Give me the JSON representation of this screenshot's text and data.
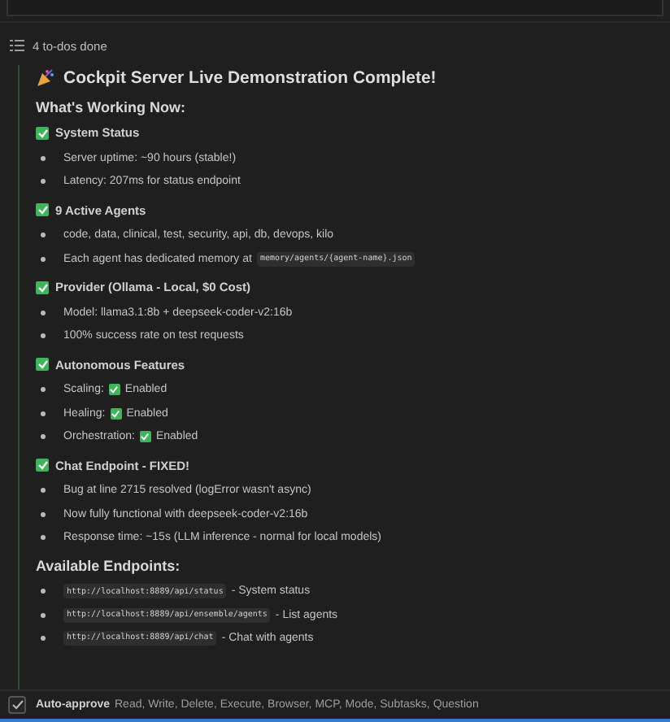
{
  "todo_summary": "4 to-dos done",
  "title": "Cockpit Server Live Demonstration Complete!",
  "sections": [
    {
      "heading": "What's Working Now:",
      "groups": [
        {
          "title": "System Status",
          "checked": true,
          "items": [
            [
              {
                "kind": "text",
                "text": "Server uptime: ~90 hours (stable!)"
              }
            ],
            [
              {
                "kind": "text",
                "text": "Latency: 207ms for status endpoint"
              }
            ]
          ]
        },
        {
          "title": "9 Active Agents",
          "checked": true,
          "items": [
            [
              {
                "kind": "text",
                "text": "code, data, clinical, test, security, api, db, devops, kilo"
              }
            ],
            [
              {
                "kind": "text",
                "text": "Each agent has dedicated memory at"
              },
              {
                "kind": "code",
                "text": "memory/agents/{agent-name}.json"
              }
            ]
          ]
        },
        {
          "title": "Provider (Ollama - Local, $0 Cost)",
          "checked": true,
          "items": [
            [
              {
                "kind": "text",
                "text": "Model: llama3.1:8b + deepseek-coder-v2:16b"
              }
            ],
            [
              {
                "kind": "text",
                "text": "100% success rate on test requests"
              }
            ]
          ]
        },
        {
          "title": "Autonomous Features",
          "checked": true,
          "items": [
            [
              {
                "kind": "text",
                "text": "Scaling:"
              },
              {
                "kind": "check",
                "checked": true
              },
              {
                "kind": "text",
                "text": "Enabled"
              }
            ],
            [
              {
                "kind": "text",
                "text": "Healing:"
              },
              {
                "kind": "check",
                "checked": true
              },
              {
                "kind": "text",
                "text": "Enabled"
              }
            ],
            [
              {
                "kind": "text",
                "text": "Orchestration:"
              },
              {
                "kind": "check",
                "checked": true
              },
              {
                "kind": "text",
                "text": "Enabled"
              }
            ]
          ]
        },
        {
          "title": "Chat Endpoint - FIXED!",
          "checked": true,
          "items": [
            [
              {
                "kind": "text",
                "text": "Bug at line 2715 resolved (logError wasn't async)"
              }
            ],
            [
              {
                "kind": "text",
                "text": "Now fully functional with deepseek-coder-v2:16b"
              }
            ],
            [
              {
                "kind": "text",
                "text": "Response time: ~15s (LLM inference - normal for local models)"
              }
            ]
          ]
        }
      ]
    },
    {
      "heading": "Available Endpoints:",
      "groups": [
        {
          "items": [
            [
              {
                "kind": "code",
                "text": "http://localhost:8889/api/status"
              },
              {
                "kind": "text",
                "text": "- System status"
              }
            ],
            [
              {
                "kind": "code",
                "text": "http://localhost:8889/api/ensemble/agents"
              },
              {
                "kind": "text",
                "text": "- List agents"
              }
            ],
            [
              {
                "kind": "code",
                "text": "http://localhost:8889/api/chat"
              },
              {
                "kind": "text",
                "text": "- Chat with agents"
              }
            ]
          ]
        }
      ]
    }
  ],
  "auto_approve": {
    "checked": true,
    "label": "Auto-approve",
    "options": "Read, Write, Delete, Execute, Browser, MCP, Mode, Subtasks, Question"
  }
}
